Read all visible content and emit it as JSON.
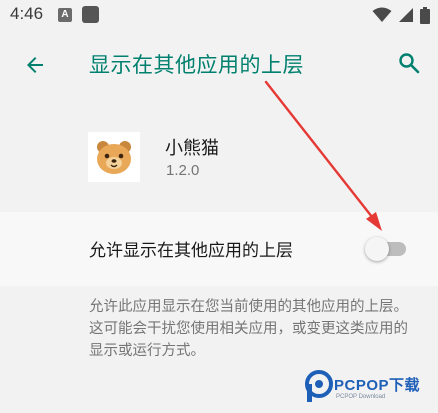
{
  "status_bar": {
    "time": "4:46",
    "notification_icons": [
      "android-auto-icon",
      "stop-square-icon"
    ],
    "right_icons": [
      "wifi-icon",
      "signal-icon",
      "battery-icon"
    ]
  },
  "app_bar": {
    "title": "显示在其他应用的上层",
    "back_icon": "arrow-back-icon",
    "search_icon": "search-icon",
    "accent_color": "#00806e"
  },
  "app_info": {
    "name": "小熊猫",
    "version": "1.2.0",
    "icon": "bear-face-icon"
  },
  "permission": {
    "label": "允许显示在其他应用的上层",
    "enabled": false
  },
  "description": "允许此应用显示在您当前使用的其他应用的上层。这可能会干扰您使用相关应用，或变更这类应用的显示或运行方式。",
  "watermark": {
    "brand": "PCPOP下载",
    "sub": "PCPOP Download"
  },
  "annotation": {
    "arrow_color": "#e53935"
  }
}
